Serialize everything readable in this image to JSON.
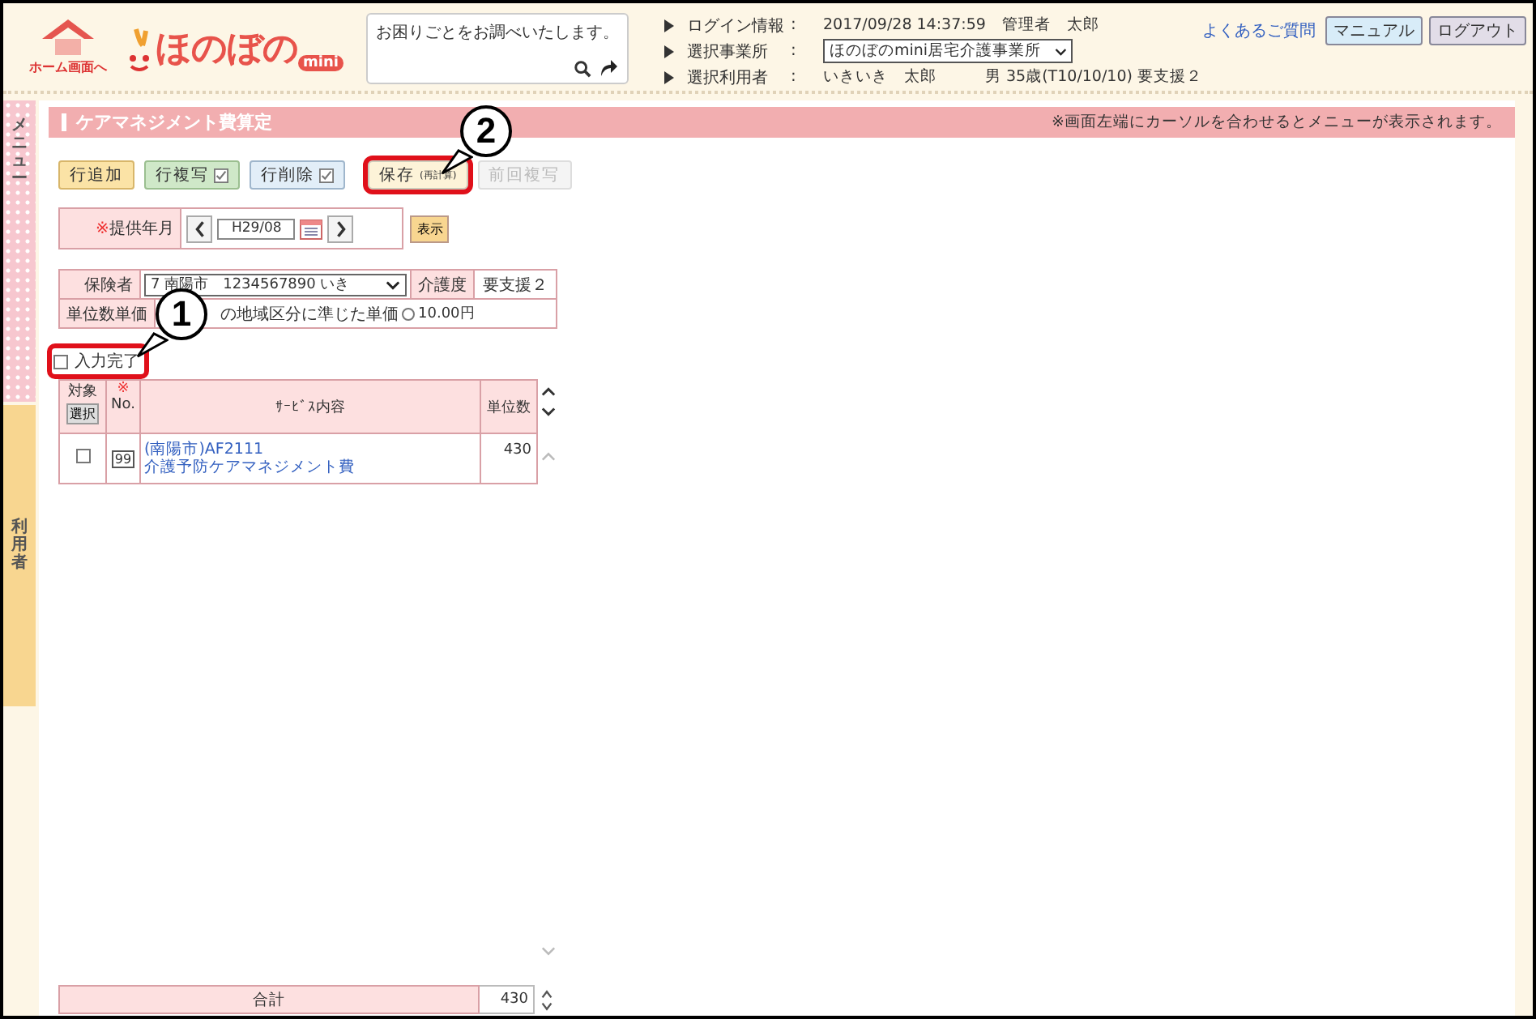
{
  "header": {
    "home_label": "ホーム画面へ",
    "logo": {
      "text": "ほのぼの",
      "badge": "mini"
    },
    "help_box": {
      "text": "お困りごとをお調べいたします。"
    },
    "info": [
      {
        "label": "ログイン情報",
        "colon": ":",
        "value": "2017/09/28 14:37:59　管理者　太郎",
        "kind": "text"
      },
      {
        "label": "選択事業所",
        "colon": ":",
        "value": "ほのぼのmini居宅介護事業所",
        "kind": "select"
      },
      {
        "label": "選択利用者",
        "colon": ":",
        "value": "いきいき　太郎　　　男 35歳(T10/10/10) 要支援２",
        "kind": "text"
      }
    ],
    "faq_link": "よくあるご質問",
    "buttons": [
      {
        "label": "マニュアル",
        "kind": "manual"
      },
      {
        "label": "ログアウト",
        "kind": "logout"
      }
    ]
  },
  "side_tabs": [
    {
      "label": "メニュー",
      "kind": "menu"
    },
    {
      "label": "利用者",
      "kind": "user"
    }
  ],
  "page": {
    "title": "ケアマネジメント費算定",
    "hint": "※画面左端にカーソルを合わせるとメニューが表示されます。"
  },
  "toolbar": [
    {
      "label": "行追加",
      "kind": "add",
      "disabled": false,
      "highlighted": false
    },
    {
      "label": "行複写",
      "kind": "copy",
      "disabled": false,
      "highlighted": false
    },
    {
      "label": "行削除",
      "kind": "delete",
      "disabled": false,
      "highlighted": false
    },
    {
      "label": "保存",
      "sub": "(再計算)",
      "kind": "save",
      "disabled": false,
      "highlighted": true
    },
    {
      "label": "前回複写",
      "kind": "prev",
      "disabled": true,
      "highlighted": false
    }
  ],
  "period": {
    "required_mark": "※",
    "label": "提供年月",
    "value": "H29/08",
    "show_button": "表示"
  },
  "insurer": {
    "label": "保険者",
    "value": "7 南陽市　1234567890 いき",
    "care_level_label": "介護度",
    "care_level": "要支援２",
    "unit_price_label": "単位数単価",
    "unit_price_text": "の地域区分に準じた単価",
    "unit_price_option": {
      "label": "10.00円",
      "selected": false
    }
  },
  "complete": {
    "label": "入力完了",
    "checked": false,
    "highlighted": true
  },
  "table": {
    "columns": [
      {
        "label": "対象",
        "button": "選択"
      },
      {
        "mark": "※",
        "label": "No."
      },
      {
        "label": "ｻｰﾋﾞｽ内容"
      },
      {
        "label": "単位数"
      }
    ],
    "rows": [
      {
        "checked": false,
        "no": "99",
        "service_code": "(南陽市)AF2111",
        "service_name": "介護予防ケアマネジメント費",
        "units": "430"
      }
    ],
    "total_label": "合計",
    "total": "430"
  },
  "callouts": [
    {
      "number": "1"
    },
    {
      "number": "2"
    }
  ]
}
